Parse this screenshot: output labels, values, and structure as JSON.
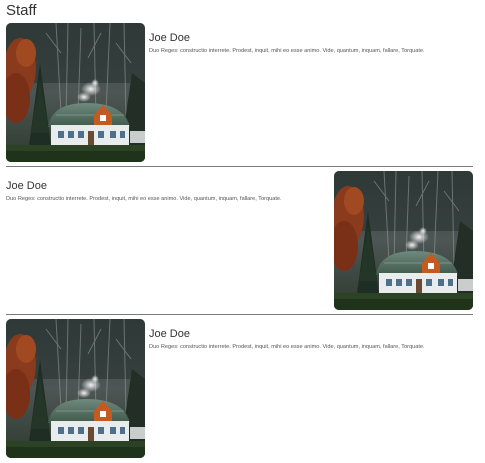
{
  "page": {
    "title": "Staff"
  },
  "staff": [
    {
      "name": "Joe Doe",
      "description": "Duo Reges: constructio interrete. Prodest, inquit, mihi eo esse animo. Vide, quantum, inquam, fallare, Torquate.",
      "image_side": "left",
      "image_subject": "house-in-forest"
    },
    {
      "name": "Joe Doe",
      "description": "Duo Reges: constructio interrete. Prodest, inquit, mihi eo esse animo. Vide, quantum, inquam, fallare, Torquate.",
      "image_side": "right",
      "image_subject": "house-in-forest"
    },
    {
      "name": "Joe Doe",
      "description": "Duo Reges: constructio interrete. Prodest, inquit, mihi eo esse animo. Vide, quantum, inquam, fallare, Torquate.",
      "image_side": "left",
      "image_subject": "house-in-forest"
    }
  ],
  "colors": {
    "text": "#333333",
    "muted_text": "#555555",
    "divider": "#7a7a7a"
  }
}
